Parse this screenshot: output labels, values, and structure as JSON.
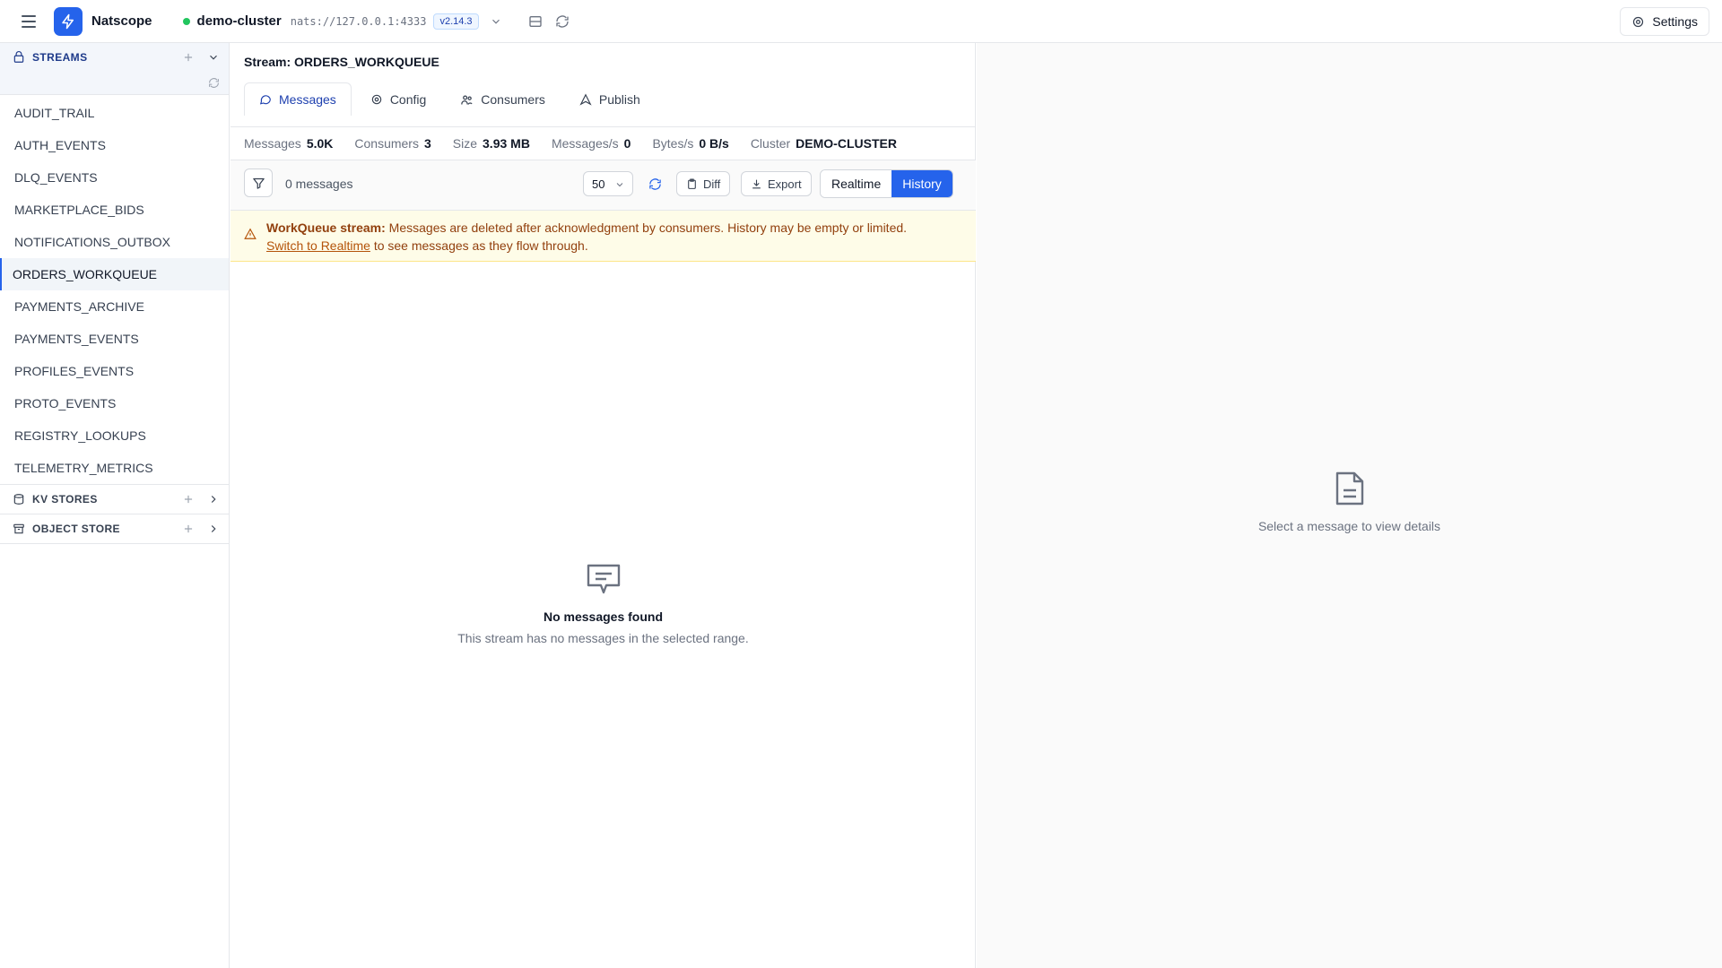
{
  "app": {
    "name": "Natscope",
    "cluster_name": "demo-cluster",
    "cluster_url": "nats://127.0.0.1:4333",
    "version": "v2.14.3",
    "settings_label": "Settings",
    "accent_color": "#2563eb",
    "status_color": "#22c55e"
  },
  "sidebar": {
    "streams_label": "STREAMS",
    "streams": [
      "AUDIT_TRAIL",
      "AUTH_EVENTS",
      "DLQ_EVENTS",
      "MARKETPLACE_BIDS",
      "NOTIFICATIONS_OUTBOX",
      "ORDERS_WORKQUEUE",
      "PAYMENTS_ARCHIVE",
      "PAYMENTS_EVENTS",
      "PROFILES_EVENTS",
      "PROTO_EVENTS",
      "REGISTRY_LOOKUPS",
      "TELEMETRY_METRICS"
    ],
    "active_stream": "ORDERS_WORKQUEUE",
    "kv_label": "KV STORES",
    "object_label": "OBJECT STORE"
  },
  "main": {
    "title": "Stream: ORDERS_WORKQUEUE",
    "tabs": [
      "Messages",
      "Config",
      "Consumers",
      "Publish"
    ],
    "active_tab": "Messages",
    "stats": [
      {
        "label": "Messages",
        "value": "5.0K"
      },
      {
        "label": "Consumers",
        "value": "3"
      },
      {
        "label": "Size",
        "value": "3.93 MB"
      },
      {
        "label": "Messages/s",
        "value": "0"
      },
      {
        "label": "Bytes/s",
        "value": "0 B/s"
      },
      {
        "label": "Cluster",
        "value": "DEMO-CLUSTER"
      }
    ],
    "toolbar": {
      "message_count": "0 messages",
      "page_size": "50",
      "diff_label": "Diff",
      "export_label": "Export",
      "realtime_label": "Realtime",
      "history_label": "History",
      "active_mode": "History"
    },
    "warning": {
      "title": "WorkQueue stream:",
      "text": " Messages are deleted after acknowledgment by consumers. History may be empty or limited.",
      "link": "Switch to Realtime",
      "after_link": " to see messages as they flow through."
    },
    "empty": {
      "title": "No messages found",
      "subtitle": "This stream has no messages in the selected range."
    }
  },
  "detail": {
    "empty_text": "Select a message to view details"
  }
}
